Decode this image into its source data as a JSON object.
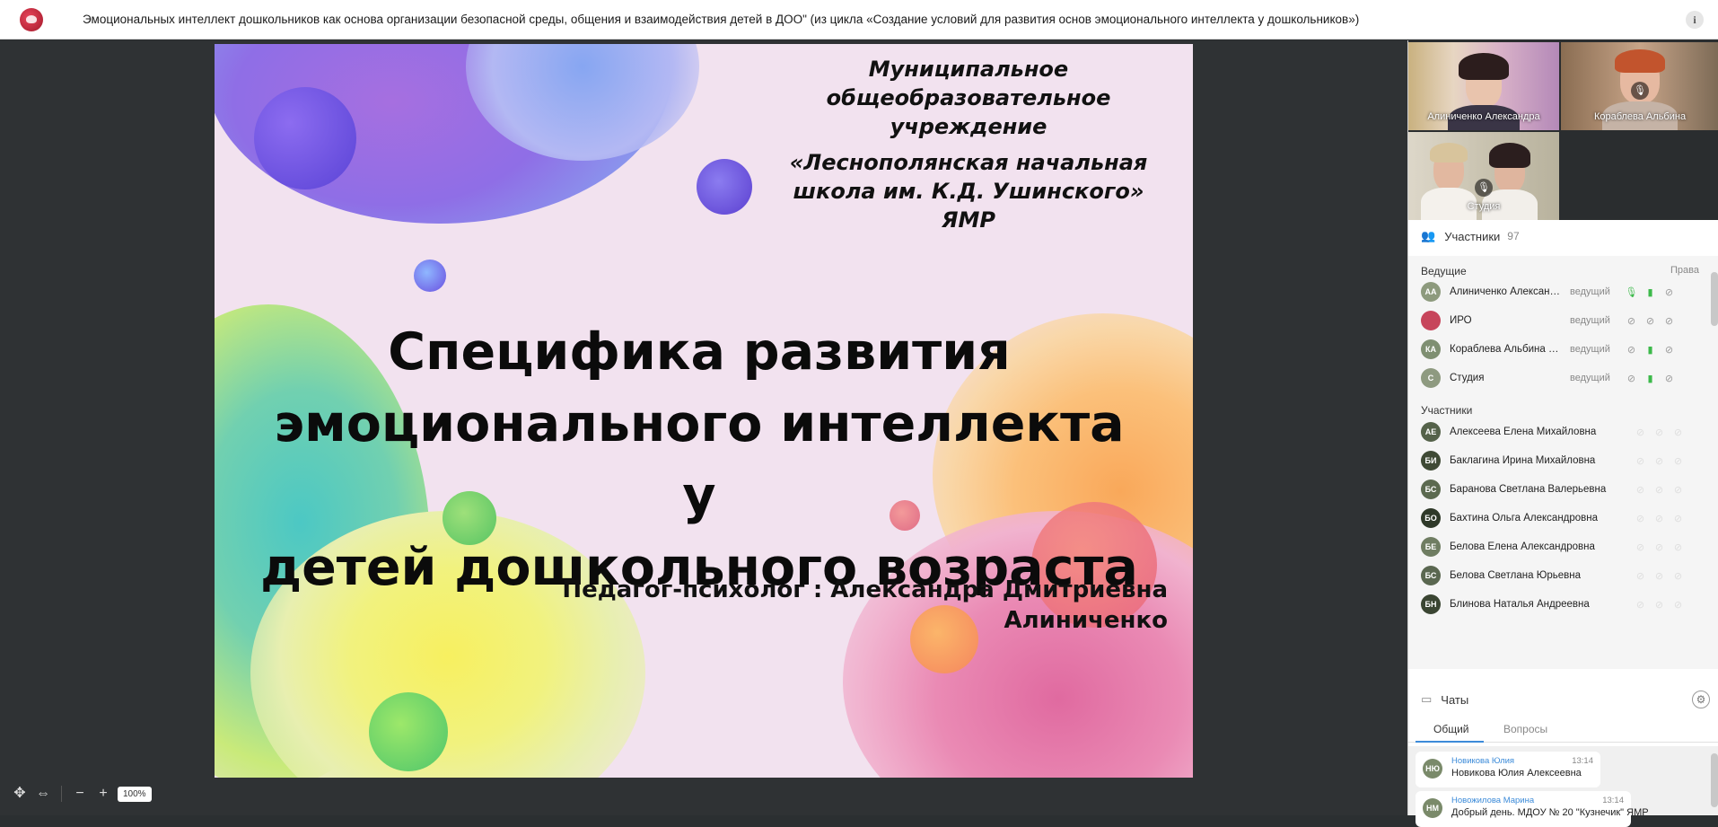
{
  "window": {
    "title": "Эмоциональных интеллект дошкольников как основа организации безопасной среды, общения и взаимодействия детей в ДОО\" (из цикла «Создание условий для развития основ эмоционального интеллекта у дошкольников»)",
    "info_icon": "info-icon"
  },
  "slide": {
    "organization": [
      "Муниципальное",
      "общеобразовательное",
      "учреждение",
      "«Леснополянская начальная",
      "школа им. К.Д. Ушинского» ЯМР"
    ],
    "headline": [
      "Специфика развития",
      "эмоционального интеллекта у",
      "детей дошкольного возраста"
    ],
    "author": [
      "Педагог-психолог : Александра Дмитриевна",
      "Алиниченко"
    ]
  },
  "zoom": {
    "value": "100%",
    "minus": "−",
    "plus": "+"
  },
  "videos": [
    {
      "name": "Алиниченко Александра"
    },
    {
      "name": "Кораблева Альбина"
    },
    {
      "name": "Студия"
    }
  ],
  "participants": {
    "header": "Участники",
    "count": "97",
    "hosts_label": "Ведущие",
    "rights_label": "Права",
    "hosts": [
      {
        "initials": "АА",
        "name": "Алиниченко Александра Дмитриевна",
        "role": "ведущий",
        "avatar_color": "#8d9a7d",
        "mic": "on",
        "cam": "on"
      },
      {
        "initials": "",
        "name": "ИРО",
        "role": "ведущий",
        "avatar_color": "#c7455b",
        "mic": "off",
        "cam": "off"
      },
      {
        "initials": "КА",
        "name": "Кораблева Альбина Александровна",
        "role": "ведущий",
        "avatar_color": "#7f8f72",
        "mic": "off",
        "cam": "on"
      },
      {
        "initials": "С",
        "name": "Студия",
        "role": "ведущий",
        "avatar_color": "#8e9a80",
        "mic": "off",
        "cam": "on"
      }
    ],
    "members_label": "Участники",
    "members": [
      {
        "initials": "АЕ",
        "name": "Алексеева Елена Михайловна",
        "avatar_color": "#55624a"
      },
      {
        "initials": "БИ",
        "name": "Баклагина Ирина Михайловна",
        "avatar_color": "#3f4a35"
      },
      {
        "initials": "БС",
        "name": "Баранова Светлана Валерьевна",
        "avatar_color": "#5c6a50"
      },
      {
        "initials": "БО",
        "name": "Бахтина Ольга Александровна",
        "avatar_color": "#2f3929"
      },
      {
        "initials": "БЕ",
        "name": "Белова Елена Александровна",
        "avatar_color": "#6f7d62"
      },
      {
        "initials": "БС",
        "name": "Белова Светлана Юрьевна",
        "avatar_color": "#5a6750"
      },
      {
        "initials": "БН",
        "name": "Блинова Наталья Андреевна",
        "avatar_color": "#3a4532"
      }
    ]
  },
  "chats": {
    "header": "Чаты",
    "tabs": [
      "Общий",
      "Вопросы"
    ],
    "messages": [
      {
        "initials": "НЮ",
        "author": "Новикова Юлия",
        "time": "13:14",
        "text": "Новикова Юлия Алексеевна"
      },
      {
        "initials": "НМ",
        "author": "Новожилова Марина",
        "time": "13:14",
        "text": "Добрый день. МДОУ № 20 \"Кузнечик\" ЯМР"
      }
    ]
  }
}
